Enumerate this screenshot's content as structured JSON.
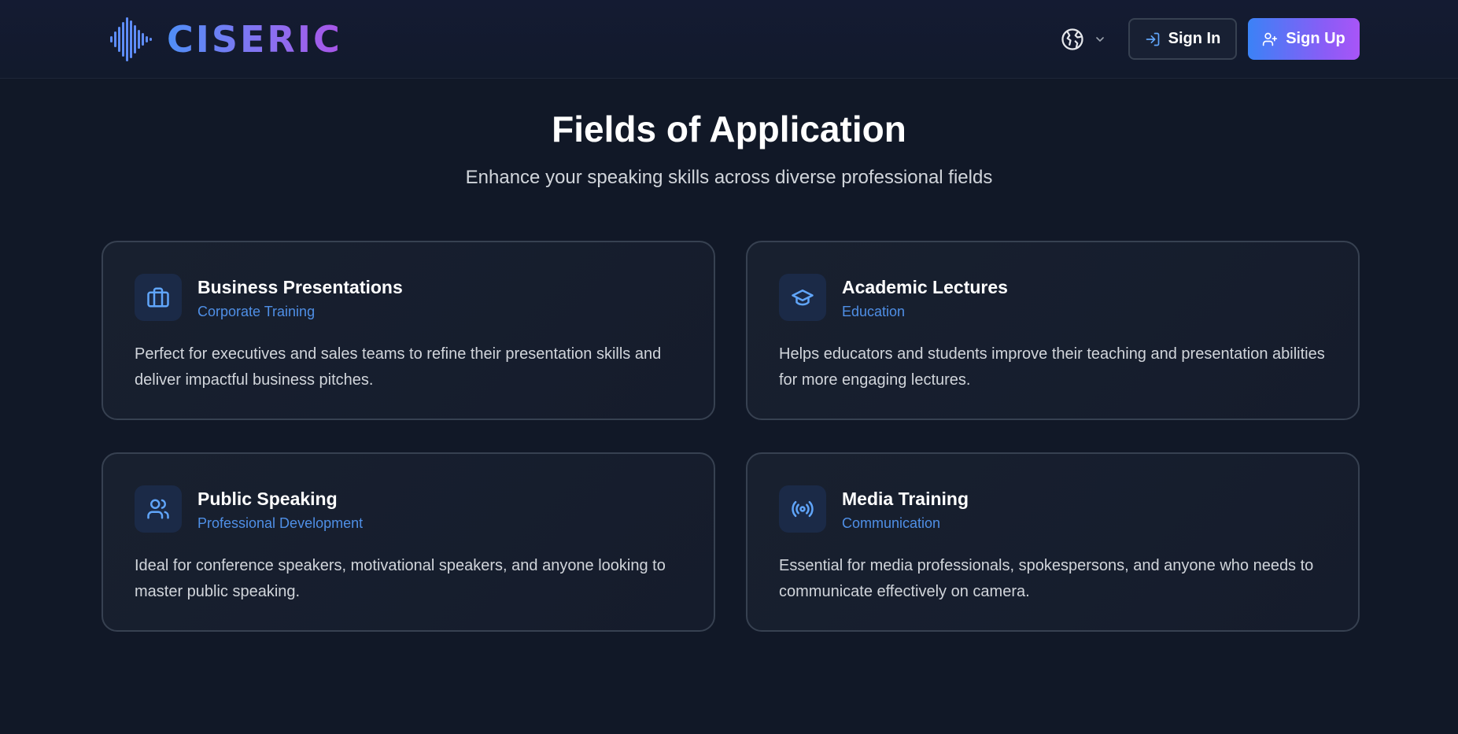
{
  "header": {
    "brand": "CISERIC",
    "signin_label": "Sign In",
    "signup_label": "Sign Up",
    "language_icon": "globe-icon"
  },
  "section": {
    "title": "Fields of Application",
    "subtitle": "Enhance your speaking skills across diverse professional fields"
  },
  "cards": [
    {
      "icon": "briefcase-icon",
      "title": "Business Presentations",
      "tag": "Corporate Training",
      "description": "Perfect for executives and sales teams to refine their presentation skills and deliver impactful business pitches."
    },
    {
      "icon": "graduation-cap-icon",
      "title": "Academic Lectures",
      "tag": "Education",
      "description": "Helps educators and students improve their teaching and presentation abilities for more engaging lectures."
    },
    {
      "icon": "users-icon",
      "title": "Public Speaking",
      "tag": "Professional Development",
      "description": "Ideal for conference speakers, motivational speakers, and anyone looking to master public speaking."
    },
    {
      "icon": "broadcast-icon",
      "title": "Media Training",
      "tag": "Communication",
      "description": "Essential for media professionals, spokespersons, and anyone who needs to communicate effectively on camera."
    }
  ],
  "colors": {
    "background": "#111827",
    "accent_blue": "#3b82f6",
    "accent_purple": "#a855f7",
    "tag_blue": "#4f8fe6"
  }
}
